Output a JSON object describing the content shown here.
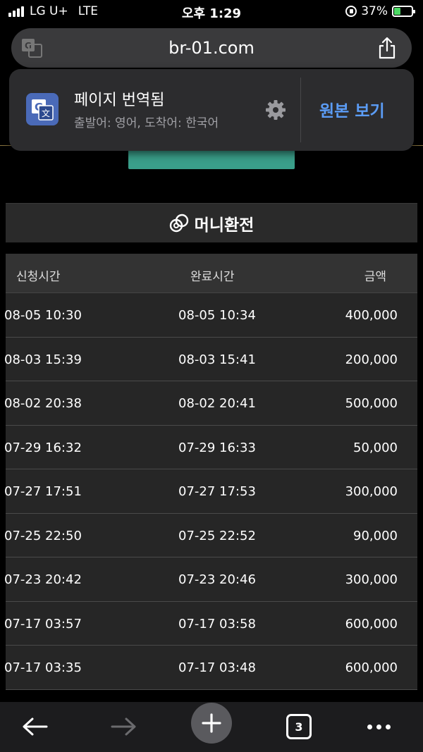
{
  "status_bar": {
    "carrier": "LG U+",
    "network": "LTE",
    "time": "오후 1:29",
    "battery_percent": "37%",
    "battery_level": 0.37
  },
  "browser": {
    "url": "br-01.com"
  },
  "translation_popup": {
    "title": "페이지 번역됨",
    "subtitle": "출발어: 영어, 도착어: 한국어",
    "show_original": "원본 보기"
  },
  "section": {
    "title": "머니환전"
  },
  "table": {
    "headers": [
      "신청시간",
      "완료시간",
      "금액"
    ],
    "rows": [
      {
        "requested": "08-05 10:30",
        "completed": "08-05 10:34",
        "amount": "400,000"
      },
      {
        "requested": "08-03 15:39",
        "completed": "08-03 15:41",
        "amount": "200,000"
      },
      {
        "requested": "08-02 20:38",
        "completed": "08-02 20:41",
        "amount": "500,000"
      },
      {
        "requested": "07-29 16:32",
        "completed": "07-29 16:33",
        "amount": "50,000"
      },
      {
        "requested": "07-27 17:51",
        "completed": "07-27 17:53",
        "amount": "300,000"
      },
      {
        "requested": "07-25 22:50",
        "completed": "07-25 22:52",
        "amount": "90,000"
      },
      {
        "requested": "07-23 20:42",
        "completed": "07-23 20:46",
        "amount": "300,000"
      },
      {
        "requested": "07-17 03:57",
        "completed": "07-17 03:58",
        "amount": "600,000"
      },
      {
        "requested": "07-17 03:35",
        "completed": "07-17 03:48",
        "amount": "600,000"
      }
    ]
  },
  "toolbar": {
    "tab_count": "3"
  },
  "colors": {
    "accent_link": "#5b9cf5",
    "green_button": "#3a9f8a",
    "battery_fill": "#4cd964"
  }
}
